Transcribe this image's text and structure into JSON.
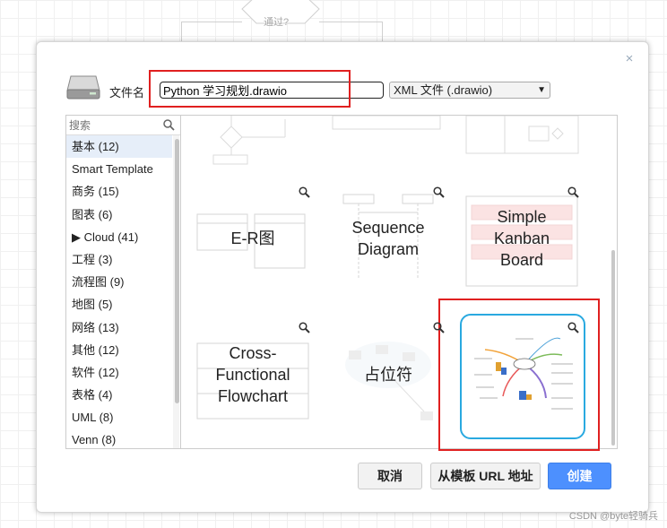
{
  "background": {
    "diamond_label": "通过?"
  },
  "dialog": {
    "close_glyph": "×",
    "filename_label": "文件名",
    "filename_value": "Python 学习规划.drawio",
    "format_selected": "XML 文件 (.drawio)",
    "icons": {
      "drive": "hard-drive-icon",
      "close": "close-icon",
      "search": "search-icon",
      "zoom": "zoom-icon"
    }
  },
  "sidebar": {
    "search_placeholder": "搜索",
    "items": [
      {
        "label": "基本 (12)",
        "active": true
      },
      {
        "label": "Smart Template"
      },
      {
        "label": "商务 (15)"
      },
      {
        "label": "图表 (6)"
      },
      {
        "label": "▶ Cloud (41)"
      },
      {
        "label": "工程 (3)"
      },
      {
        "label": "流程图 (9)"
      },
      {
        "label": "地图 (5)"
      },
      {
        "label": "网络 (13)"
      },
      {
        "label": "其他 (12)"
      },
      {
        "label": "软件 (12)"
      },
      {
        "label": "表格 (4)"
      },
      {
        "label": "UML (8)"
      },
      {
        "label": "Venn (8)"
      }
    ]
  },
  "templates": {
    "er": "E-R图",
    "sequence_1": "Sequence",
    "sequence_2": "Diagram",
    "kanban_1": "Simple",
    "kanban_2": "Kanban",
    "kanban_3": "Board",
    "cross_1": "Cross-",
    "cross_2": "Functional",
    "cross_3": "Flowchart",
    "placeholder": "占位符"
  },
  "buttons": {
    "cancel": "取消",
    "from_template": "从模板 URL 地址",
    "create": "创建"
  },
  "colors": {
    "create_button": "#4d90fe",
    "selected_border": "#29a9e0",
    "annotation_red": "#e02020"
  },
  "watermark": "CSDN @byte轻骑兵"
}
